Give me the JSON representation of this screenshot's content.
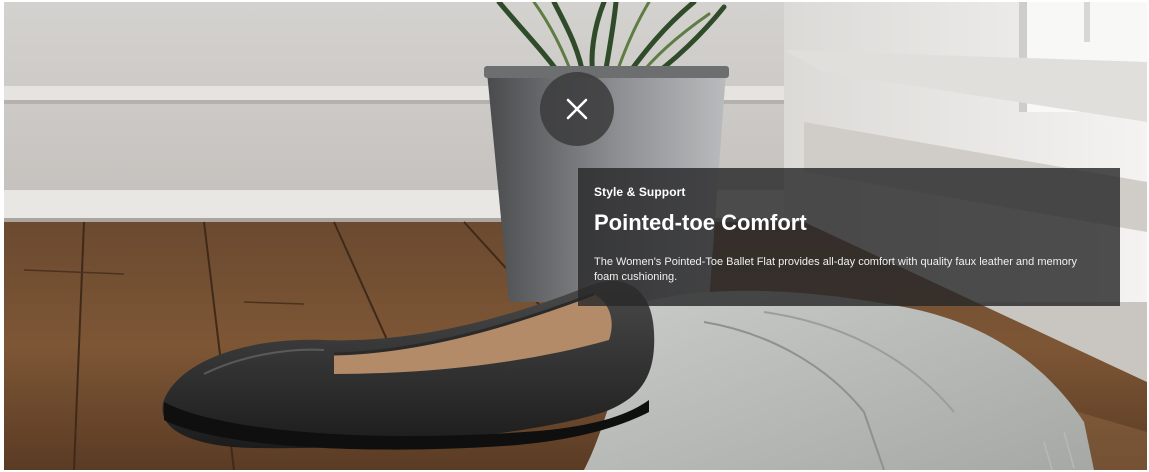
{
  "hero": {
    "image_alt_subject": "black-ballet-flat-on-wooden-floor",
    "close_icon": "close-icon",
    "panel": {
      "eyebrow": "Style & Support",
      "headline": "Pointed-toe Comfort",
      "description": "The Women's Pointed-Toe Ballet Flat provides all-day comfort with quality faux leather and memory foam cushioning."
    }
  },
  "colors": {
    "panel_bg": "#28282a",
    "close_bg": "#3c3c3e",
    "text": "#ffffff"
  }
}
